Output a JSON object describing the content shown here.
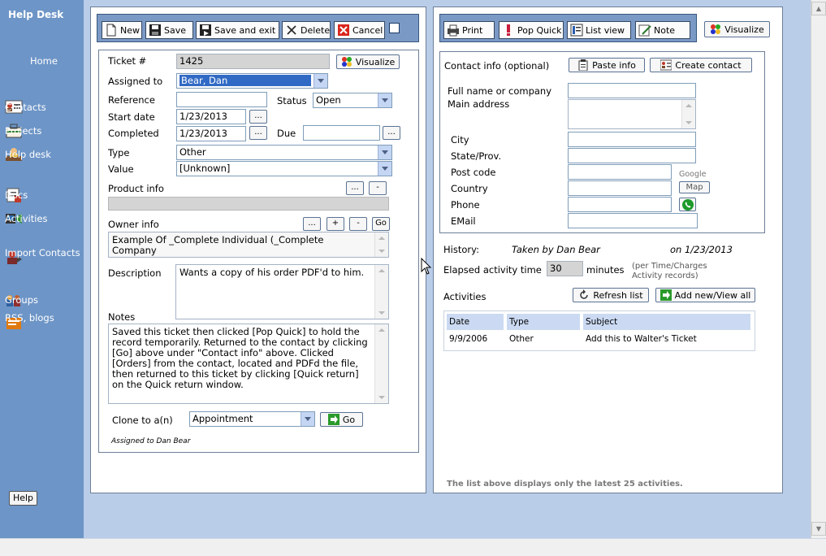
{
  "sidebar": {
    "title": "Help Desk",
    "items": [
      {
        "label": "Home"
      },
      {
        "label": "Contacts"
      },
      {
        "label": "Projects"
      },
      {
        "label": "Help desk"
      },
      {
        "label": "Docs"
      },
      {
        "label": "Activities"
      },
      {
        "label": "Import Contacts"
      },
      {
        "label": "Groups"
      },
      {
        "label": "RSS, blogs"
      }
    ],
    "help_label": "Help"
  },
  "left_toolbar": {
    "new": "New",
    "save": "Save",
    "save_exit": "Save and exit",
    "delete": "Delete",
    "cancel": "Cancel"
  },
  "ticket": {
    "ticket_label": "Ticket #",
    "ticket_value": "1425",
    "visualize": "Visualize",
    "assigned_label": "Assigned to",
    "assigned_value": "Bear, Dan",
    "reference_label": "Reference",
    "reference_value": "",
    "status_label": "Status",
    "status_value": "Open",
    "start_label": "Start date",
    "start_value": "1/23/2013",
    "completed_label": "Completed",
    "completed_value": "1/23/2013",
    "due_label": "Due",
    "due_value": "",
    "ellipsis": "...",
    "type_label": "Type",
    "type_value": "Other",
    "value_label": "Value",
    "value_value": "[Unknown]",
    "product_label": "Product info",
    "minus": "-",
    "plus": "+",
    "owner_label": "Owner info",
    "go": "Go",
    "owner_value": "Example Of _Complete Individual (_Complete Company",
    "description_label": "Description",
    "description_value": "Wants a copy of his order PDF'd to him.",
    "notes_label": "Notes",
    "notes_value": "Saved this ticket then clicked [Pop Quick] to hold the record temporarily. Returned to the contact by clicking [Go] above under \"Contact info\" above. Clicked [Orders] from the contact, located and PDFd the file, then returned to this ticket by clicking [Quick return] on the Quick return window.",
    "clone_label": "Clone to a(n)",
    "clone_value": "Appointment",
    "clone_go": "Go",
    "assigned_note": "Assigned to Dan Bear"
  },
  "right_toolbar": {
    "print": "Print",
    "pop_quick": "Pop Quick",
    "list_view": "List view",
    "note": "Note",
    "visualize": "Visualize"
  },
  "contact": {
    "header": "Contact info (optional)",
    "paste": "Paste info",
    "create": "Create contact",
    "fullname_label": "Full name or company",
    "address_label": "Main address",
    "city_label": "City",
    "state_label": "State/Prov.",
    "post_label": "Post code",
    "country_label": "Country",
    "phone_label": "Phone",
    "email_label": "EMail",
    "google_label": "Google",
    "map_label": "Map"
  },
  "history": {
    "label": "History:",
    "taken": "Taken by Dan Bear",
    "on": "on 1/23/2013",
    "elapsed_label": "Elapsed activity time",
    "elapsed_value": "30",
    "minutes": "minutes",
    "note": "(per Time/Charges Activity records)"
  },
  "activities": {
    "label": "Activities",
    "refresh": "Refresh list",
    "add": "Add new/View all",
    "columns": [
      "Date",
      "Type",
      "Subject"
    ],
    "rows": [
      {
        "date": "9/9/2006",
        "type": "Other",
        "subject": "Add this to Walter's Ticket"
      }
    ],
    "footer": "The list above displays only the latest 25 activities."
  }
}
